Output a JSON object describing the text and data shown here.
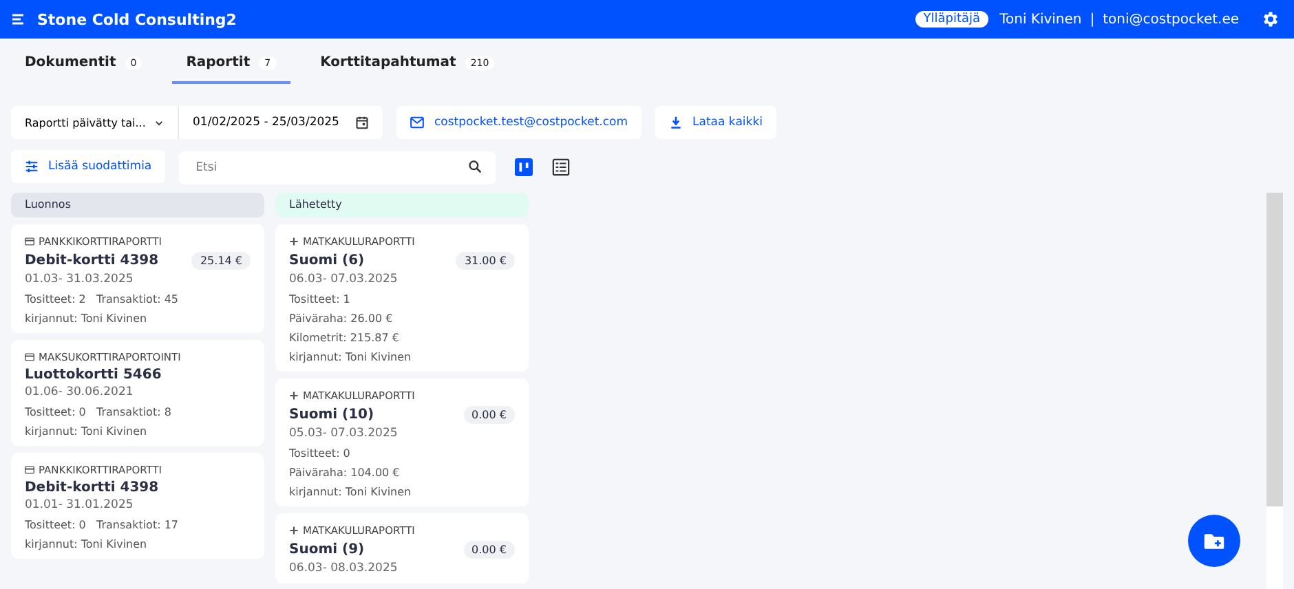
{
  "header": {
    "title": "Stone Cold Consulting2",
    "role_badge": "Ylläpitäjä",
    "user_name": "Toni Kivinen",
    "separator": "|",
    "email": "toni@costpocket.ee"
  },
  "tabs": [
    {
      "label": "Dokumentit",
      "count": "0",
      "selected": false
    },
    {
      "label": "Raportit",
      "count": "7",
      "selected": true
    },
    {
      "label": "Korttitapahtumat",
      "count": "210",
      "selected": false
    }
  ],
  "filters": {
    "sort_select": "Raportti päivätty tai...",
    "date_range": "01/02/2025 - 25/03/2025",
    "email_button": "costpocket.test@costpocket.com",
    "download_button": "Lataa kaikki",
    "add_filters_button": "Lisää suodattimia",
    "search": {
      "placeholder": "Etsi"
    },
    "view_mode": {
      "board_selected": true
    }
  },
  "columns": [
    {
      "title": "Luonnos",
      "kind": "draft",
      "cards": [
        {
          "kind": "card",
          "type": "PANKKIKORTTIRAPORTTI",
          "title": "Debit-kortti 4398",
          "amount": "25.14 €",
          "date": "01.03- 31.03.2025",
          "lines": [
            "Tositteet: 2   Transaktiot: 45",
            "kirjannut: Toni Kivinen"
          ]
        },
        {
          "kind": "card",
          "type": "MAKSUKORTTIRAPORTOINTI",
          "title": "Luottokortti 5466",
          "date": "01.06- 30.06.2021",
          "lines": [
            "Tositteet: 0   Transaktiot: 8",
            "kirjannut: Toni Kivinen"
          ]
        },
        {
          "kind": "card",
          "type": "PANKKIKORTTIRAPORTTI",
          "title": "Debit-kortti 4398",
          "date": "01.01- 31.01.2025",
          "lines": [
            "Tositteet: 0   Transaktiot: 17",
            "kirjannut: Toni Kivinen"
          ]
        }
      ]
    },
    {
      "title": "Lähetetty",
      "kind": "sent",
      "cards": [
        {
          "kind": "trip",
          "type": "MATKAKULURAPORTTI",
          "title": "Suomi (6)",
          "amount": "31.00 €",
          "date": "06.03- 07.03.2025",
          "lines": [
            "Tositteet: 1",
            "Päiväraha: 26.00 €",
            "Kilometrit: 215.87 €",
            "kirjannut: Toni Kivinen"
          ]
        },
        {
          "kind": "trip",
          "type": "MATKAKULURAPORTTI",
          "title": "Suomi (10)",
          "amount": "0.00 €",
          "date": "05.03- 07.03.2025",
          "lines": [
            "Tositteet: 0",
            "Päiväraha: 104.00 €",
            "kirjannut: Toni Kivinen"
          ]
        },
        {
          "kind": "trip",
          "type": "MATKAKULURAPORTTI",
          "title": "Suomi (9)",
          "amount": "0.00 €",
          "date": "06.03- 08.03.2025"
        }
      ]
    }
  ]
}
